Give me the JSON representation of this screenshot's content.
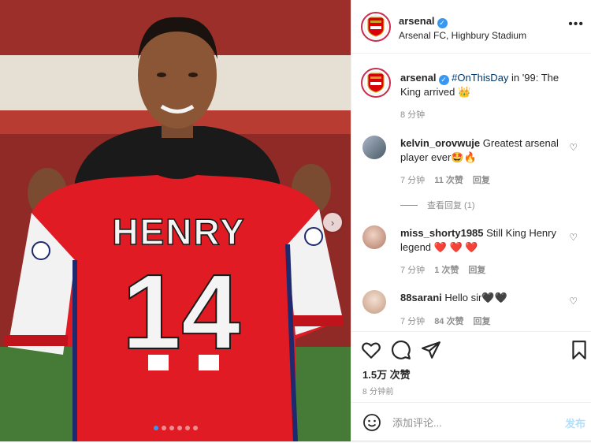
{
  "post": {
    "username": "arsenal",
    "location": "Arsenal FC, Highbury Stadium",
    "more_label": "•••"
  },
  "photo": {
    "shirt_name": "HENRY",
    "shirt_number": "14",
    "slide_count": 6,
    "active_slide": 1
  },
  "caption": {
    "username": "arsenal",
    "hashtag": "#OnThisDay",
    "text": " in '99: The King arrived ",
    "emoji": "👑",
    "time": "8 分钟"
  },
  "comments": [
    {
      "username": "kelvin_orovwuje",
      "text": " Greatest arsenal player ever🤩🔥",
      "time": "7 分钟",
      "likes": "11 次赞",
      "reply": "回复",
      "view_replies": "查看回复 (1)"
    },
    {
      "username": "miss_shorty1985",
      "text": " Still King Henry legend ❤️ ❤️ ❤️",
      "time": "7 分钟",
      "likes": "1 次赞",
      "reply": "回复"
    },
    {
      "username": "88sarani",
      "text": " Hello sir🖤🖤",
      "time": "7 分钟",
      "likes": "84 次赞",
      "reply": "回复"
    }
  ],
  "actions": {
    "like_count": "1.5万 次赞",
    "posted": "8 分钟前"
  },
  "add_comment": {
    "placeholder": "添加评论...",
    "post_label": "发布"
  },
  "colors": {
    "link_blue": "#00376b",
    "verified_blue": "#3897f0",
    "post_button_disabled": "#b2dffc",
    "arsenal_red": "#db0007"
  }
}
